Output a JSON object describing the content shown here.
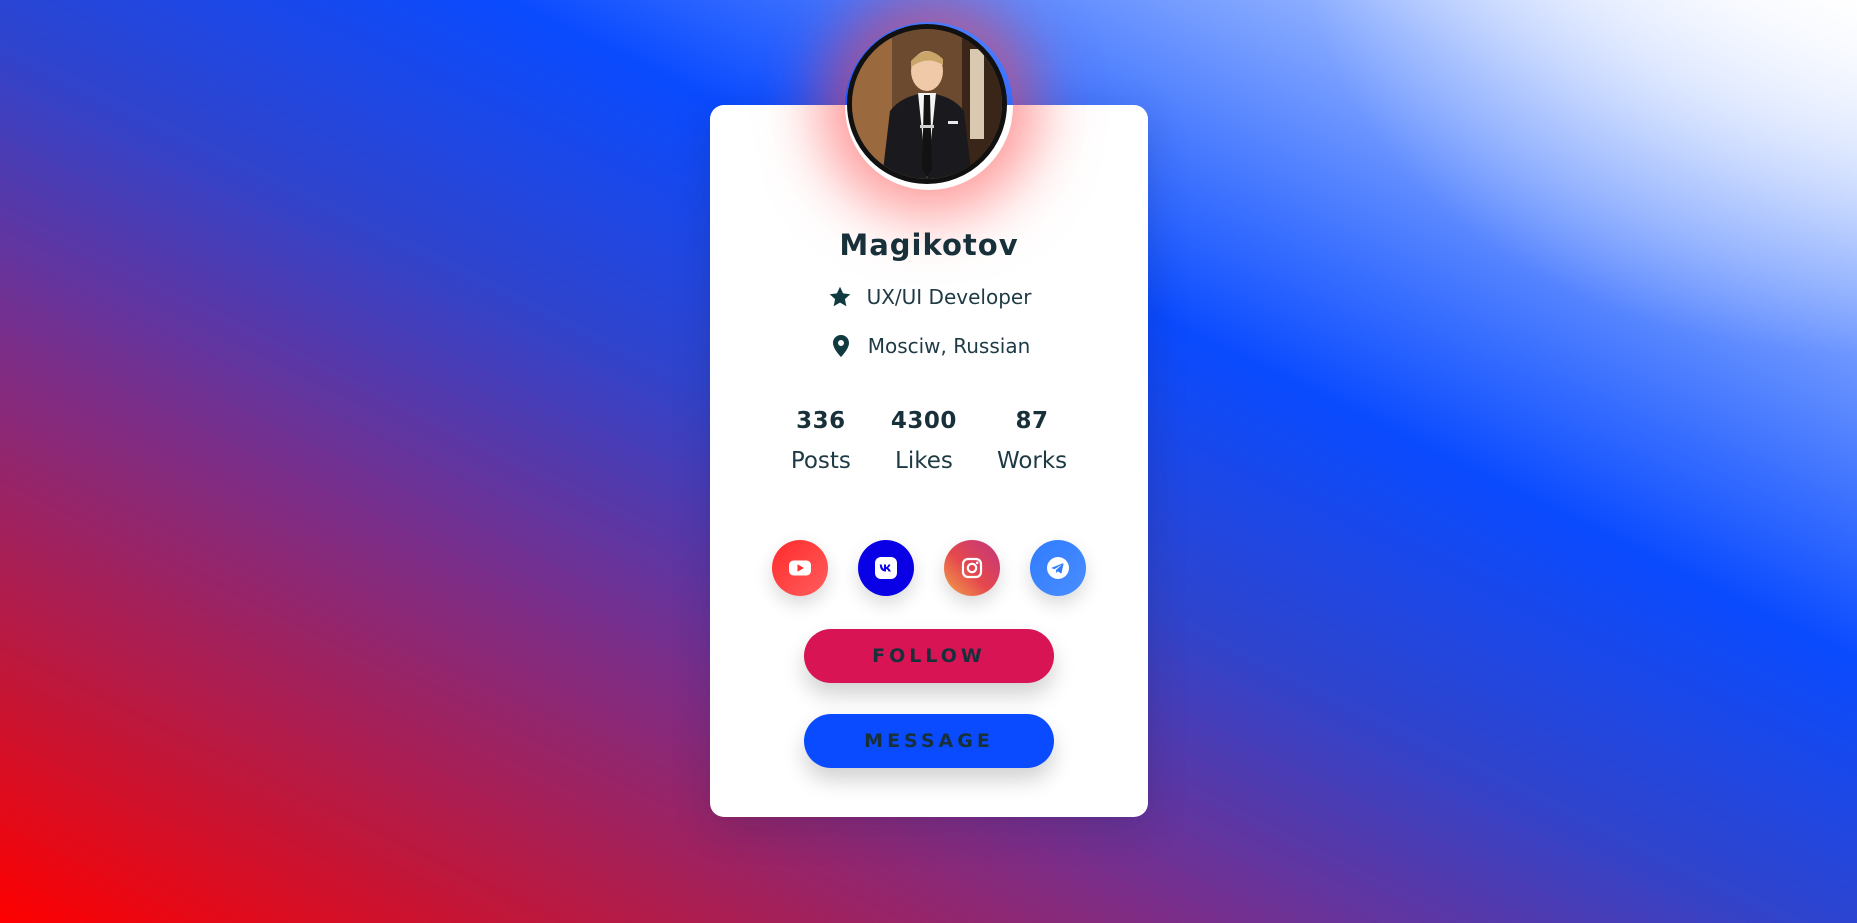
{
  "profile": {
    "name": "Magikotov",
    "role": "UX/UI Developer",
    "location": "Mosciw, Russian"
  },
  "stats": [
    {
      "value": "336",
      "label": "Posts"
    },
    {
      "value": "4300",
      "label": "Likes"
    },
    {
      "value": "87",
      "label": "Works"
    }
  ],
  "socials": [
    {
      "name": "youtube",
      "icon": "youtube-icon",
      "color": "#ff2a2a"
    },
    {
      "name": "vk",
      "icon": "vk-icon",
      "color": "#0a00e6"
    },
    {
      "name": "instagram",
      "icon": "instagram-icon",
      "color": "#e5484d"
    },
    {
      "name": "telegram",
      "icon": "telegram-icon",
      "color": "#2f7cff"
    }
  ],
  "actions": {
    "follow_label": "FOLLOW",
    "message_label": "MESSAGE"
  },
  "colors": {
    "follow": "#d81454",
    "message": "#0a4bff",
    "text": "#18303a",
    "avatar_glow": "#ff4646"
  }
}
